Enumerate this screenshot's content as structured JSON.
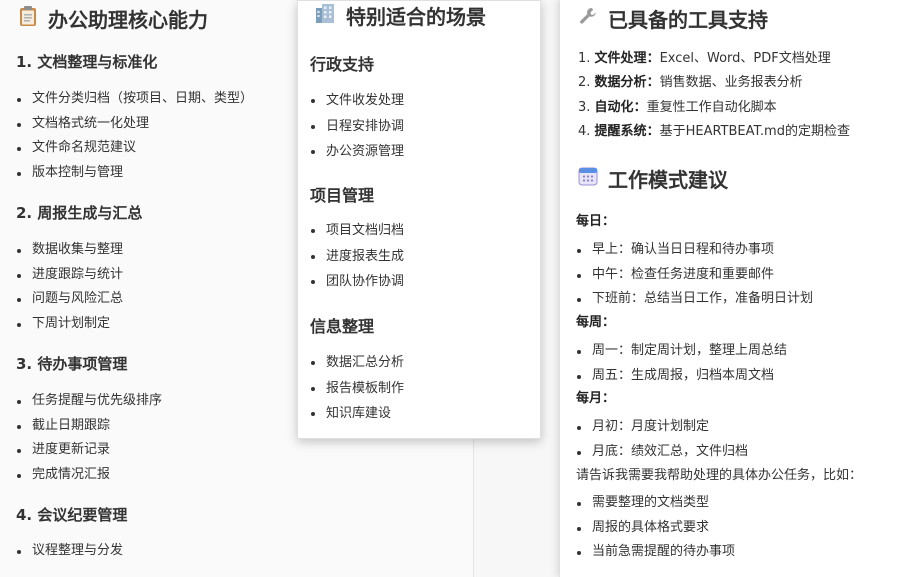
{
  "left": {
    "title": "办公助理核心能力",
    "title_icon": "clipboard-icon",
    "sections": [
      {
        "heading": "1. 文档整理与标准化",
        "items": [
          "文件分类归档（按项目、日期、类型）",
          "文档格式统一化处理",
          "文件命名规范建议",
          "版本控制与管理"
        ]
      },
      {
        "heading": "2. 周报生成与汇总",
        "items": [
          "数据收集与整理",
          "进度跟踪与统计",
          "问题与风险汇总",
          "下周计划制定"
        ]
      },
      {
        "heading": "3. 待办事项管理",
        "items": [
          "任务提醒与优先级排序",
          "截止日期跟踪",
          "进度更新记录",
          "完成情况汇报"
        ]
      },
      {
        "heading": "4. 会议纪要管理",
        "items": [
          "议程整理与分发"
        ]
      }
    ]
  },
  "center": {
    "title": "特别适合的场景",
    "title_icon": "office-building-icon",
    "sections": [
      {
        "heading": "行政支持",
        "items": [
          "文件收发处理",
          "日程安排协调",
          "办公资源管理"
        ]
      },
      {
        "heading": "项目管理",
        "items": [
          "项目文档归档",
          "进度报表生成",
          "团队协作协调"
        ]
      },
      {
        "heading": "信息整理",
        "items": [
          "数据汇总分析",
          "报告模板制作",
          "知识库建设"
        ]
      }
    ]
  },
  "right": {
    "tools_title": "已具备的工具支持",
    "tools_icon": "wrench-icon",
    "tools": [
      {
        "num": "1.",
        "name": "文件处理",
        "desc": "Excel、Word、PDF文档处理"
      },
      {
        "num": "2.",
        "name": "数据分析",
        "desc": "销售数据、业务报表分析"
      },
      {
        "num": "3.",
        "name": "自动化",
        "desc": "重复性工作自动化脚本"
      },
      {
        "num": "4.",
        "name": "提醒系统",
        "desc": "基于HEARTBEAT.md的定期检查"
      }
    ],
    "mode_title": "工作模式建议",
    "mode_icon": "calendar-icon",
    "daily_label": "每日：",
    "daily": [
      "早上：确认当日日程和待办事项",
      "中午：检查任务进度和重要邮件",
      "下班前：总结当日工作，准备明日计划"
    ],
    "weekly_label": "每周：",
    "weekly": [
      "周一：制定周计划，整理上周总结",
      "周五：生成周报，归档本周文档"
    ],
    "monthly_label": "每月：",
    "monthly": [
      "月初：月度计划制定",
      "月底：绩效汇总，文件归档"
    ],
    "prompt": "请告诉我需要我帮助处理的具体办公任务，比如：",
    "examples": [
      "需要整理的文档类型",
      "周报的具体格式要求",
      "当前急需提醒的待办事项"
    ]
  }
}
